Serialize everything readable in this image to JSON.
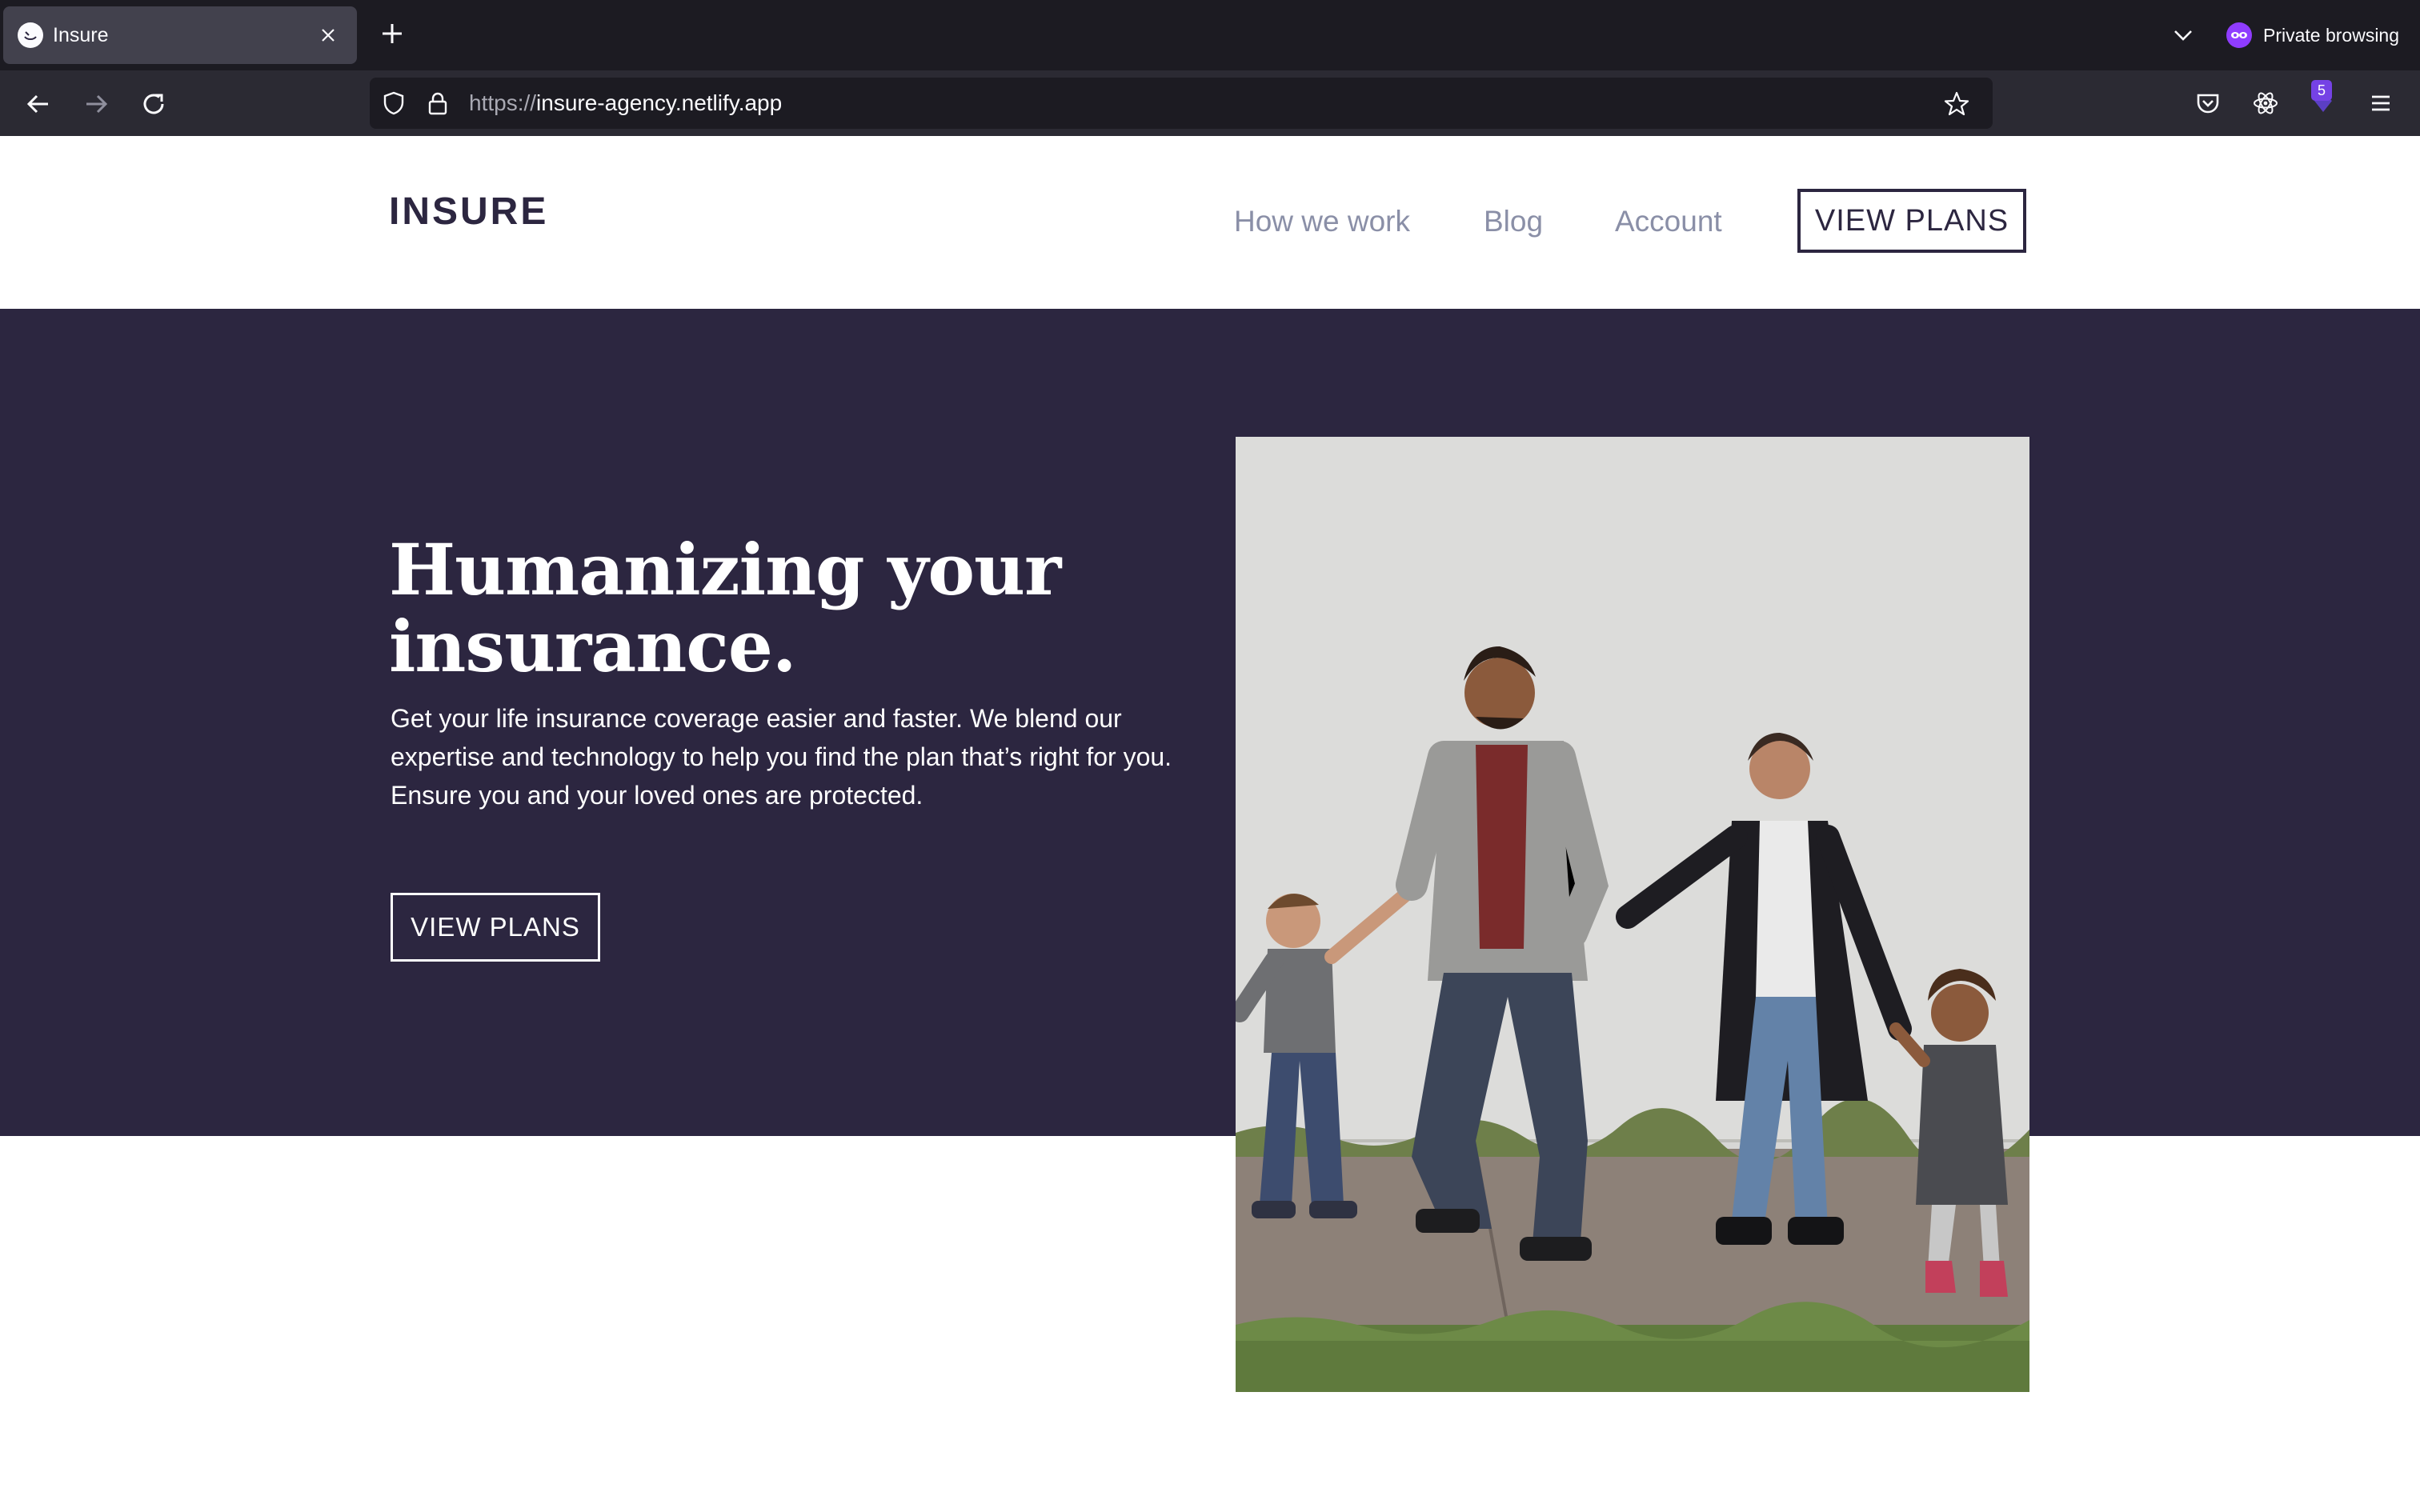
{
  "browser": {
    "tab_title": "Insure",
    "private_label": "Private browsing",
    "url_scheme": "https://",
    "url_host": "insure-agency.netlify.app",
    "extension_badge": "5"
  },
  "site": {
    "logo_text": "INSURE",
    "nav": [
      "How we work",
      "Blog",
      "Account"
    ],
    "header_cta": "VIEW PLANS",
    "hero": {
      "title": "Humanizing your insurance.",
      "text": "Get your life insurance coverage easier and faster. We blend our expertise and technology to help you find the plan that’s right for you. Ensure you and your loved ones are protected.",
      "cta": "VIEW PLANS"
    }
  },
  "colors": {
    "brand_dark": "#2c2640",
    "nav_link": "#8a8fa7",
    "white": "#ffffff"
  },
  "icons": [
    "back-icon",
    "forward-icon",
    "reload-icon",
    "shield-icon",
    "lock-icon",
    "star-icon",
    "pocket-icon",
    "react-devtools-icon",
    "extension-icon",
    "menu-icon",
    "private-mask-icon"
  ]
}
